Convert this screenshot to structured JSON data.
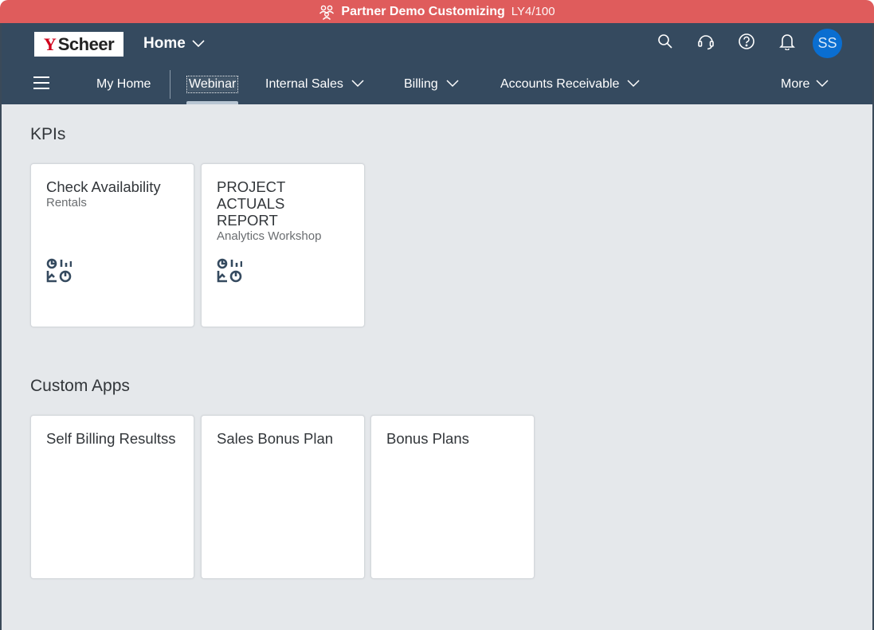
{
  "env_bar": {
    "title": "Partner Demo Customizing",
    "system": "LY4/100",
    "color": "#df5c5c"
  },
  "header": {
    "logo_mark": "Y",
    "logo_text": "Scheer",
    "app_title": "Home",
    "avatar_initials": "SS",
    "background": "#354a5f"
  },
  "nav": {
    "items": [
      {
        "label": "My Home"
      },
      {
        "label": "Webinar",
        "active": true
      },
      {
        "label": "Internal Sales"
      },
      {
        "label": "Billing"
      },
      {
        "label": "Accounts Receivable"
      },
      {
        "label": "More"
      }
    ]
  },
  "sections": [
    {
      "title": "KPIs",
      "tiles": [
        {
          "title": "Check Availability",
          "subtitle": "Rentals",
          "icon": "kpi-icon"
        },
        {
          "title": "PROJECT ACTUALS REPORT",
          "subtitle": "Analytics Workshop",
          "icon": "kpi-icon"
        }
      ]
    },
    {
      "title": "Custom Apps",
      "tiles": [
        {
          "title": "Self Billing Resultss"
        },
        {
          "title": "Sales Bonus Plan"
        },
        {
          "title": "Bonus Plans"
        }
      ]
    }
  ]
}
